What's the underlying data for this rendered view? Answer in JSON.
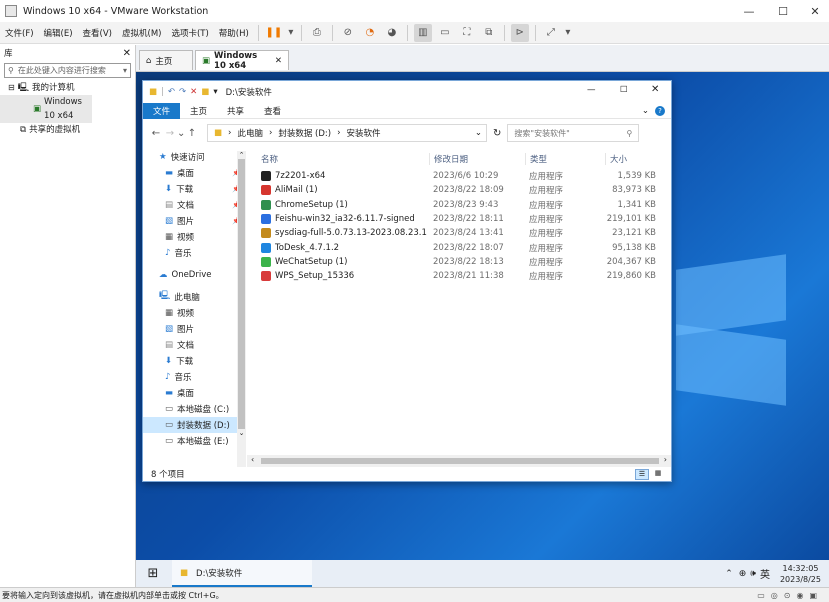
{
  "window": {
    "title": "Windows 10 x64 - VMware Workstation"
  },
  "menu": [
    "文件(F)",
    "编辑(E)",
    "查看(V)",
    "虚拟机(M)",
    "选项卡(T)",
    "帮助(H)"
  ],
  "library": {
    "title": "库",
    "search_placeholder": "在此处键入内容进行搜索",
    "tree": {
      "root": "我的计算机",
      "vm": "Windows 10 x64",
      "shared": "共享的虚拟机"
    }
  },
  "vm_tabs": [
    {
      "label": "主页"
    },
    {
      "label": "Windows 10 x64"
    }
  ],
  "explorer": {
    "title": "D:\\安装软件",
    "ribbon_tabs": [
      "文件",
      "主页",
      "共享",
      "查看"
    ],
    "breadcrumb": [
      "此电脑",
      "封装数据 (D:)",
      "安装软件"
    ],
    "search_placeholder": "搜索\"安装软件\"",
    "nav": {
      "quick_access": "快速访问",
      "qa_items": [
        "桌面",
        "下载",
        "文档",
        "图片",
        "视频",
        "音乐"
      ],
      "onedrive": "OneDrive",
      "this_pc": "此电脑",
      "pc_items": [
        "视频",
        "图片",
        "文档",
        "下载",
        "音乐",
        "桌面",
        "本地磁盘 (C:)",
        "封装数据 (D:)",
        "本地磁盘 (E:)"
      ]
    },
    "columns": {
      "name": "名称",
      "date": "修改日期",
      "type": "类型",
      "size": "大小"
    },
    "files": [
      {
        "name": "7z2201-x64",
        "date": "2023/6/6 10:29",
        "type": "应用程序",
        "size": "1,539 KB",
        "color": "#222222"
      },
      {
        "name": "AliMail (1)",
        "date": "2023/8/22 18:09",
        "type": "应用程序",
        "size": "83,973 KB",
        "color": "#d6362f"
      },
      {
        "name": "ChromeSetup (1)",
        "date": "2023/8/23 9:43",
        "type": "应用程序",
        "size": "1,341 KB",
        "color": "#2f8f4e"
      },
      {
        "name": "Feishu-win32_ia32-6.11.7-signed",
        "date": "2023/8/22 18:11",
        "type": "应用程序",
        "size": "219,101 KB",
        "color": "#2b6fe0"
      },
      {
        "name": "sysdiag-full-5.0.73.13-2023.08.23.1",
        "date": "2023/8/24 13:41",
        "type": "应用程序",
        "size": "23,121 KB",
        "color": "#c38a1c"
      },
      {
        "name": "ToDesk_4.7.1.2",
        "date": "2023/8/22 18:07",
        "type": "应用程序",
        "size": "95,138 KB",
        "color": "#1f86e0"
      },
      {
        "name": "WeChatSetup (1)",
        "date": "2023/8/22 18:13",
        "type": "应用程序",
        "size": "204,367 KB",
        "color": "#3bb34a"
      },
      {
        "name": "WPS_Setup_15336",
        "date": "2023/8/21 11:38",
        "type": "应用程序",
        "size": "219,860 KB",
        "color": "#d83b3b"
      }
    ],
    "status": "8 个项目"
  },
  "taskbar": {
    "item": "D:\\安装软件",
    "ime": "英",
    "time": "14:32:05",
    "date": "2023/8/25"
  },
  "hint": "要将输入定向到该虚拟机，请在虚拟机内部单击或按 Ctrl+G。"
}
